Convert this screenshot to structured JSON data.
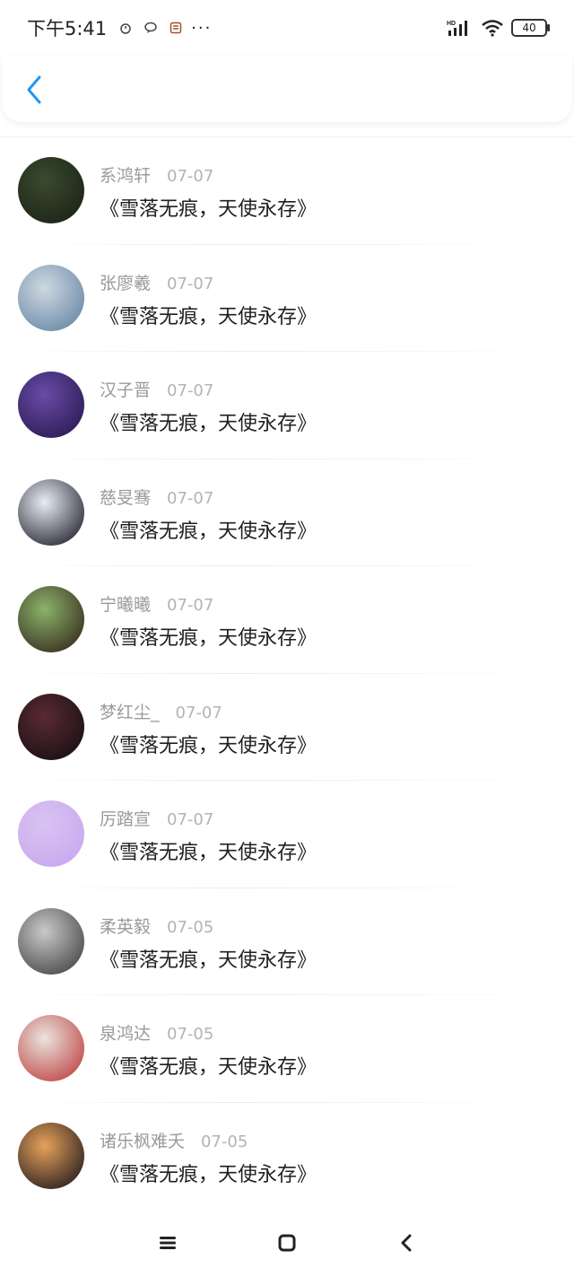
{
  "status_bar": {
    "time": "下午5:41",
    "network": "HD",
    "battery": "40"
  },
  "items": [
    {
      "name": "系鸿轩",
      "date": "07-07",
      "content": "《雪落无痕，天使永存》",
      "avatar_colors": [
        "#3a4a2e",
        "#1d2418"
      ]
    },
    {
      "name": "张廖羲",
      "date": "07-07",
      "content": "《雪落无痕，天使永存》",
      "avatar_colors": [
        "#cfd8e2",
        "#6c8aa8"
      ]
    },
    {
      "name": "汉子晋",
      "date": "07-07",
      "content": "《雪落无痕，天使永存》",
      "avatar_colors": [
        "#6a4aa8",
        "#2b1d55"
      ]
    },
    {
      "name": "慈旻骞",
      "date": "07-07",
      "content": "《雪落无痕，天使永存》",
      "avatar_colors": [
        "#e8edf4",
        "#2a2a35"
      ]
    },
    {
      "name": "宁曦曦",
      "date": "07-07",
      "content": "《雪落无痕，天使永存》",
      "avatar_colors": [
        "#8bb36b",
        "#3a3020"
      ]
    },
    {
      "name": "梦红尘_",
      "date": "07-07",
      "content": "《雪落无痕，天使永存》",
      "avatar_colors": [
        "#5a2a33",
        "#1a1015"
      ]
    },
    {
      "name": "厉踏宣",
      "date": "07-07",
      "content": "《雪落无痕，天使永存》",
      "avatar_colors": [
        "#d9c3f2",
        "#c9a9ef"
      ]
    },
    {
      "name": "柔英毅",
      "date": "07-05",
      "content": "《雪落无痕，天使永存》",
      "avatar_colors": [
        "#c9c9c9",
        "#4a4a4a"
      ]
    },
    {
      "name": "泉鸿达",
      "date": "07-05",
      "content": "《雪落无痕，天使永存》",
      "avatar_colors": [
        "#e9e4dd",
        "#c04a4a"
      ]
    },
    {
      "name": "诸乐枫难夭",
      "date": "07-05",
      "content": "《雪落无痕，天使永存》",
      "avatar_colors": [
        "#e7a25a",
        "#2a2020"
      ]
    }
  ],
  "colors": {
    "accent": "#2196f3"
  }
}
